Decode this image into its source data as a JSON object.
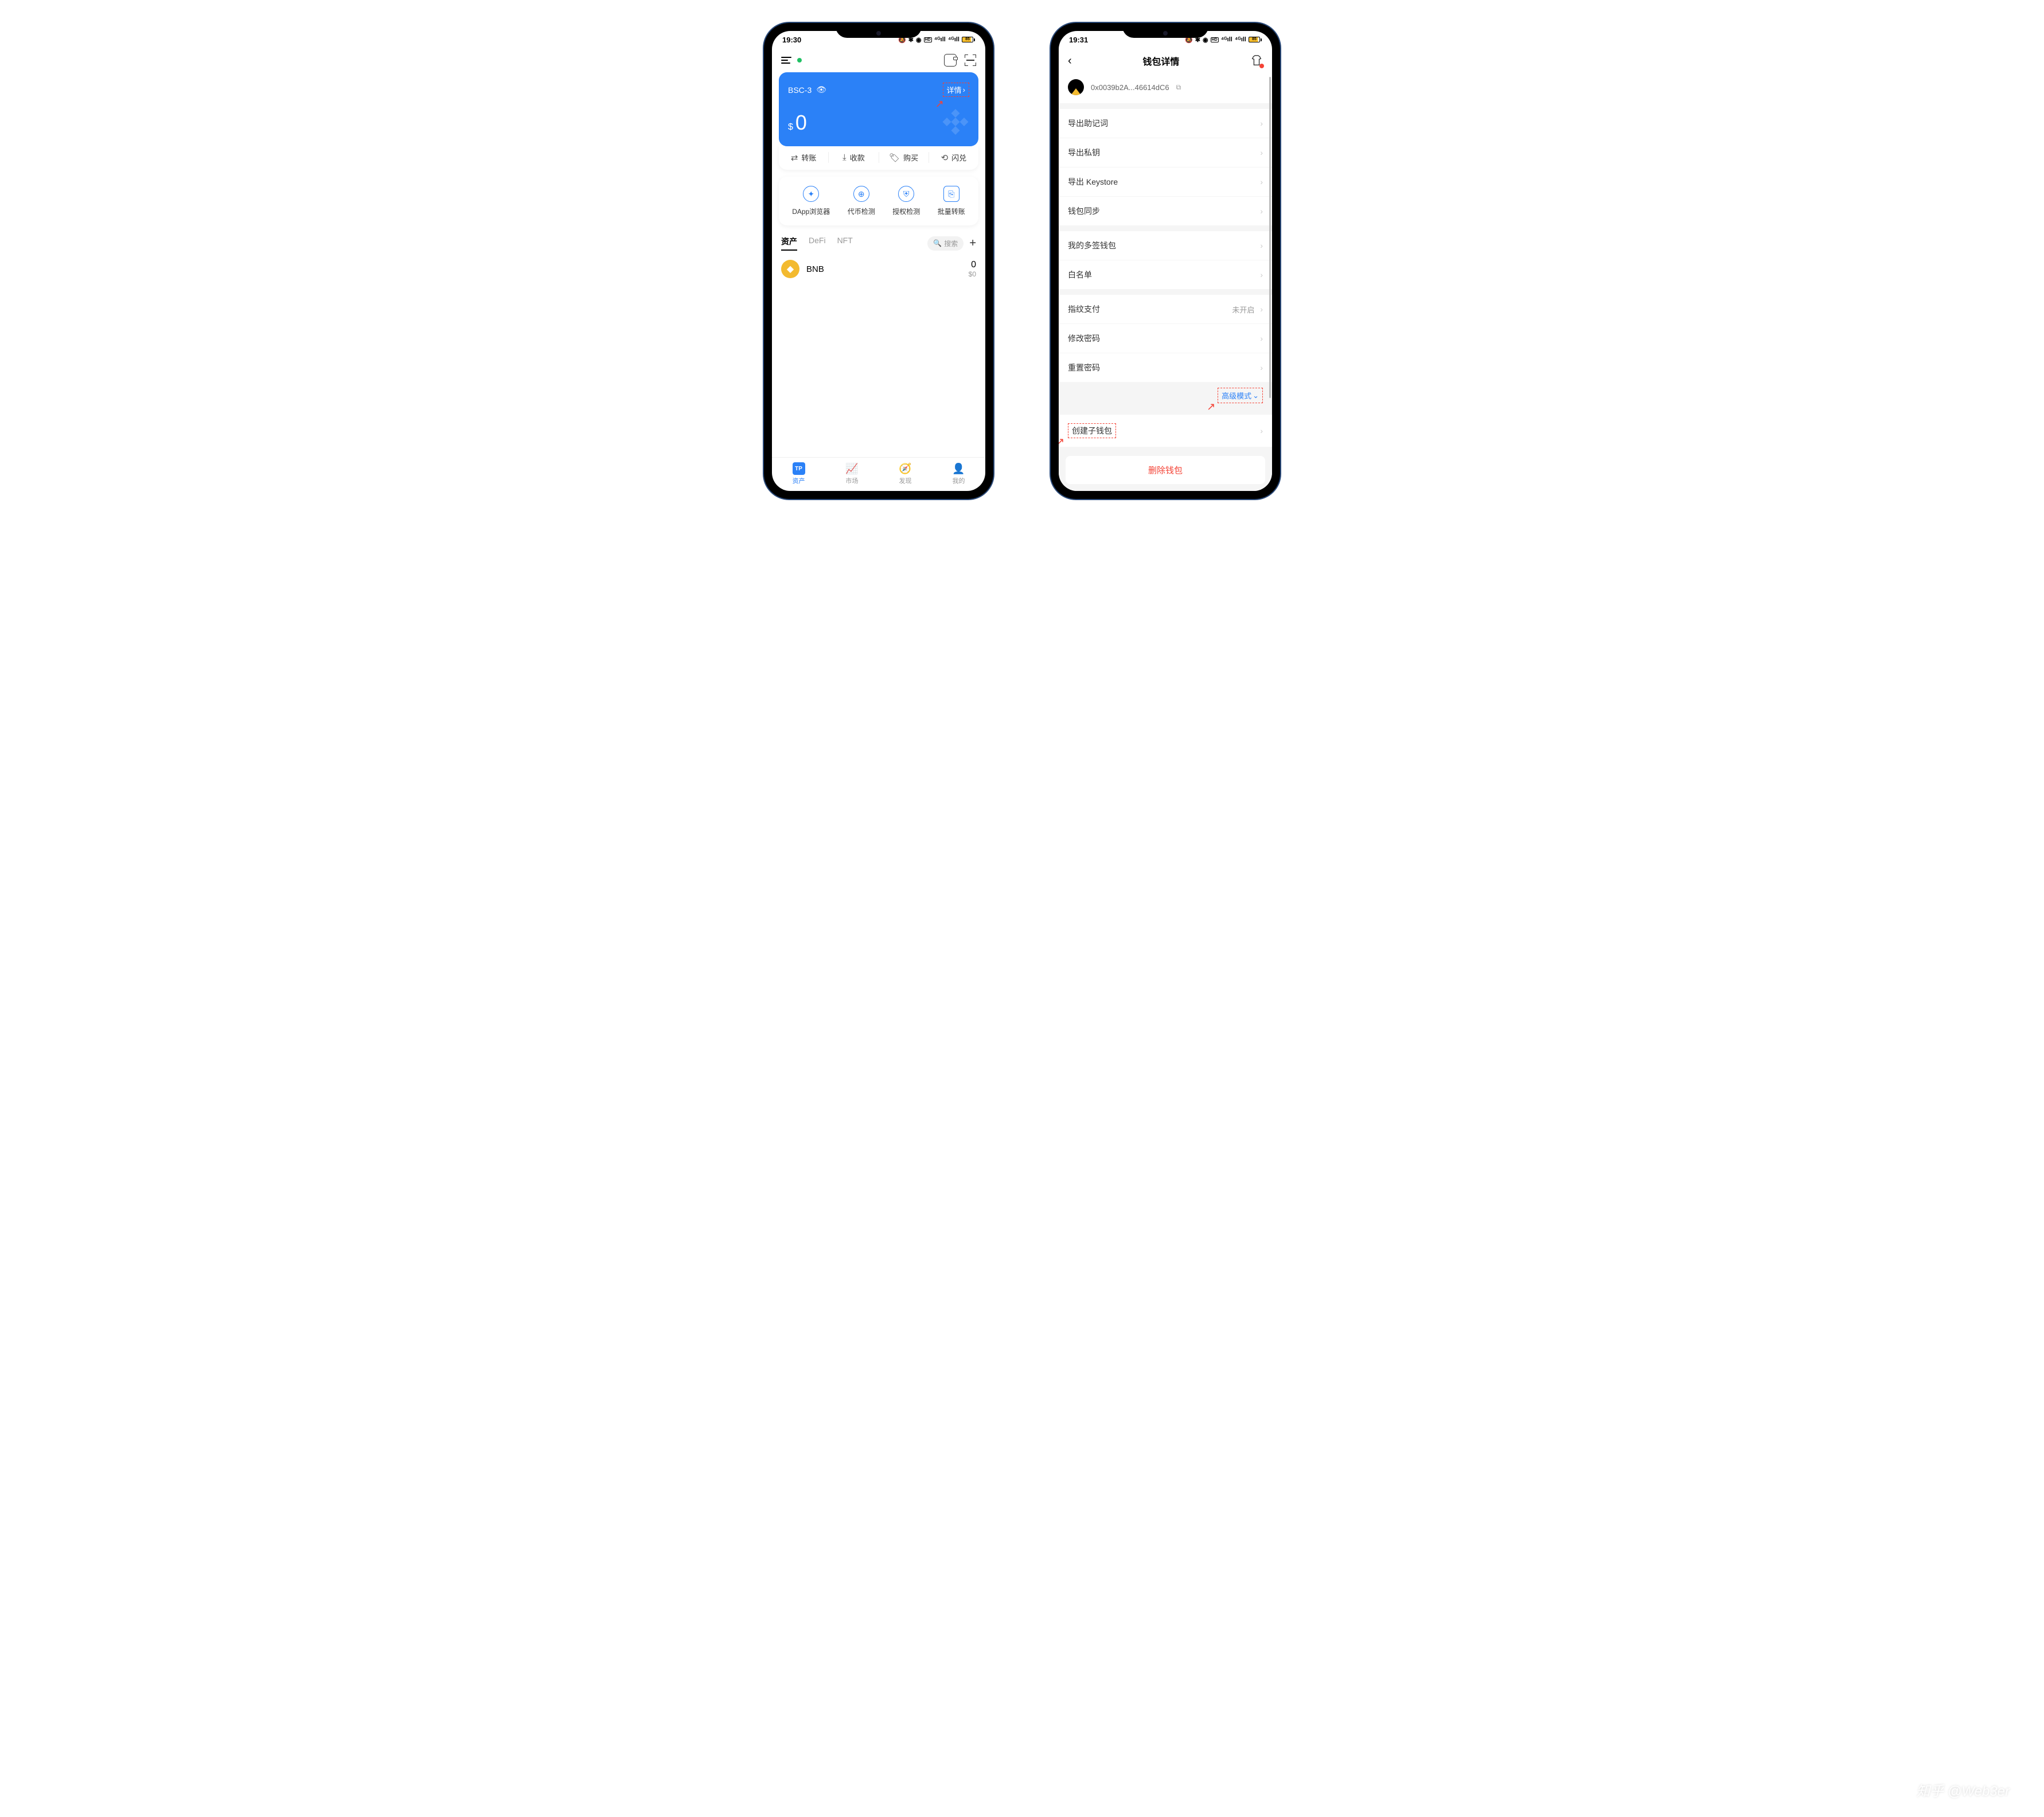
{
  "watermark": "知乎 @Web3er",
  "phone1": {
    "status": {
      "time": "19:30",
      "battery": "85"
    },
    "card": {
      "name": "BSC-3",
      "details": "详情",
      "currency": "$",
      "balance": "0"
    },
    "actions": {
      "transfer": "转账",
      "receive": "收款",
      "buy": "购买",
      "swap": "闪兑"
    },
    "tools": {
      "dapp": "DApp浏览器",
      "token": "代币检测",
      "auth": "授权检测",
      "batch": "批量转账"
    },
    "tabs": {
      "assets": "资产",
      "defi": "DeFi",
      "nft": "NFT",
      "search": "搜索"
    },
    "asset": {
      "name": "BNB",
      "amount": "0",
      "usd": "$0"
    },
    "nav": {
      "assets": "资产",
      "market": "市场",
      "discover": "发现",
      "mine": "我的"
    }
  },
  "phone2": {
    "status": {
      "time": "19:31",
      "battery": "85"
    },
    "title": "钱包详情",
    "address": "0x0039b2A...46614dC6",
    "items": {
      "mnemonic": "导出助记词",
      "privkey": "导出私钥",
      "keystore": "导出 Keystore",
      "sync": "钱包同步",
      "multisig": "我的多签钱包",
      "whitelist": "白名单",
      "fingerprint": "指纹支付",
      "fingerprint_val": "未开启",
      "changepwd": "修改密码",
      "resetpwd": "重置密码"
    },
    "advanced": "高级模式",
    "create_sub": "创建子钱包",
    "delete": "删除钱包"
  }
}
